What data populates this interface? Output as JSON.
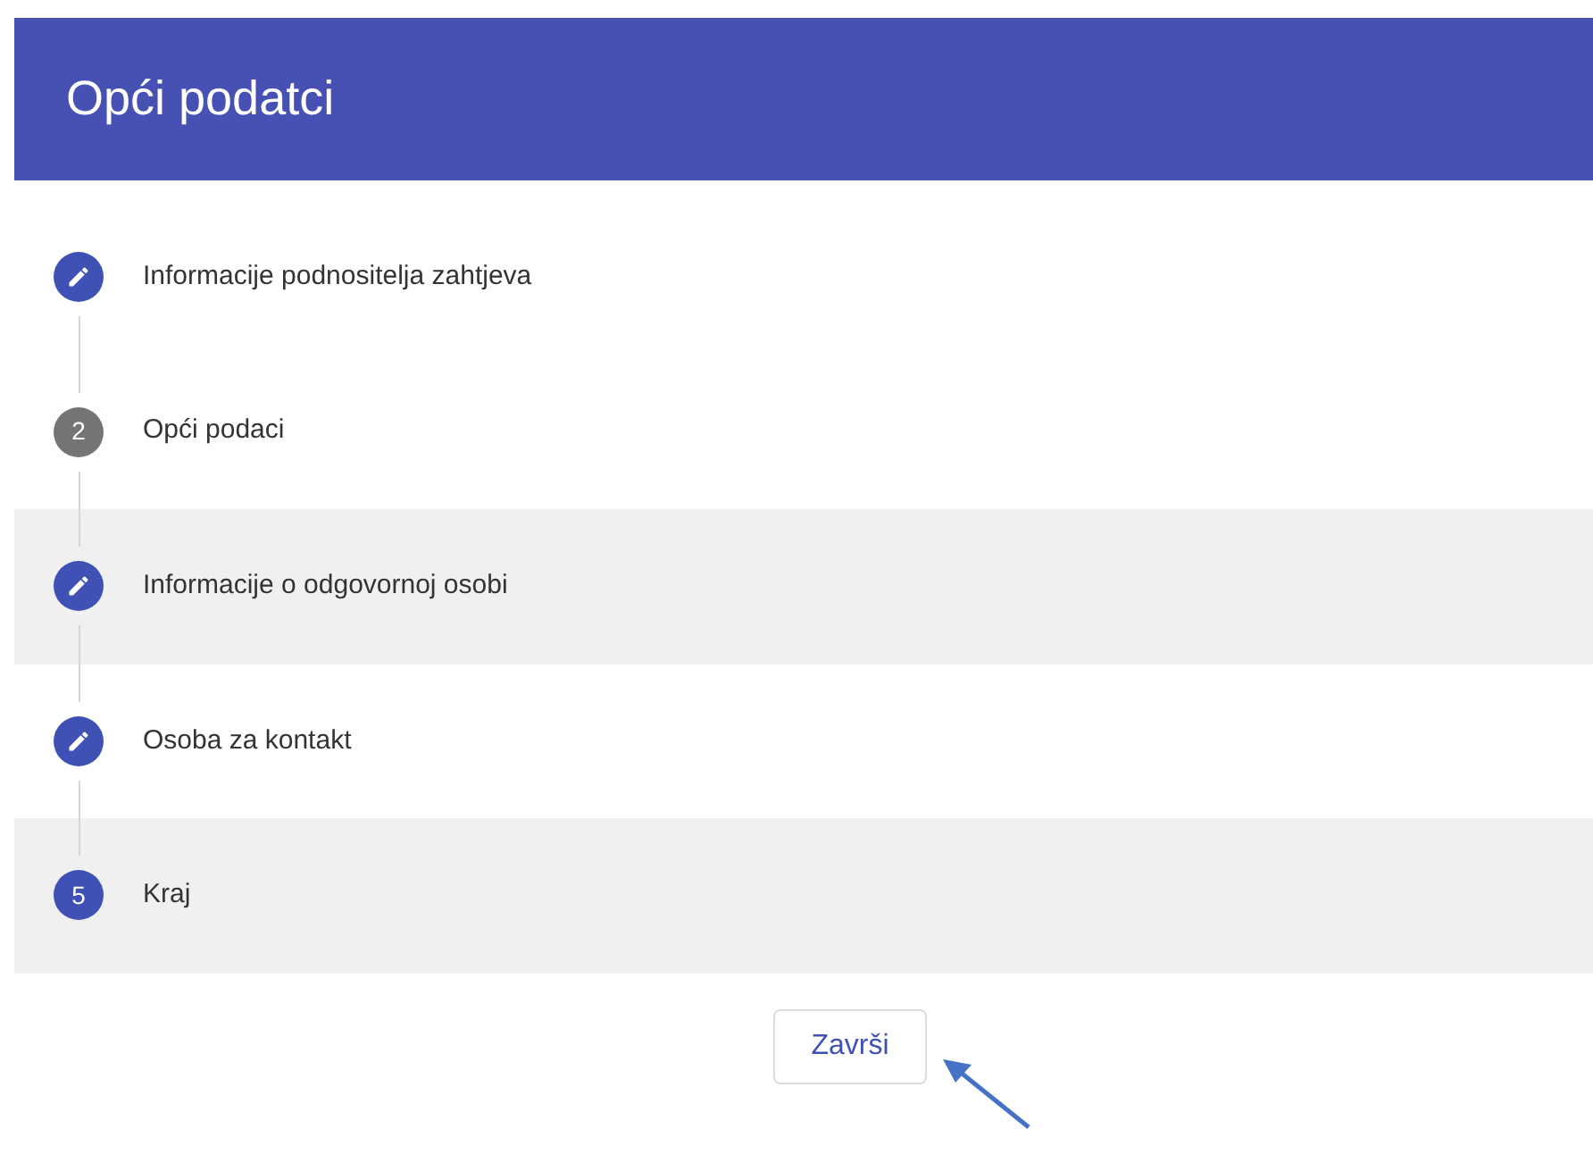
{
  "header": {
    "title": "Opći podatci"
  },
  "steps": [
    {
      "kind": "edited",
      "label": "Informacije podnositelja zahtjeva",
      "active": true,
      "shaded": false
    },
    {
      "kind": "number",
      "number": "2",
      "label": "Opći podaci",
      "active": false,
      "shaded": false
    },
    {
      "kind": "edited",
      "label": "Informacije o odgovornoj osobi",
      "active": true,
      "shaded": true
    },
    {
      "kind": "edited",
      "label": "Osoba za kontakt",
      "active": true,
      "shaded": false
    },
    {
      "kind": "number",
      "number": "5",
      "label": "Kraj",
      "active": true,
      "shaded": true
    }
  ],
  "finish_button": {
    "label": "Završi"
  }
}
